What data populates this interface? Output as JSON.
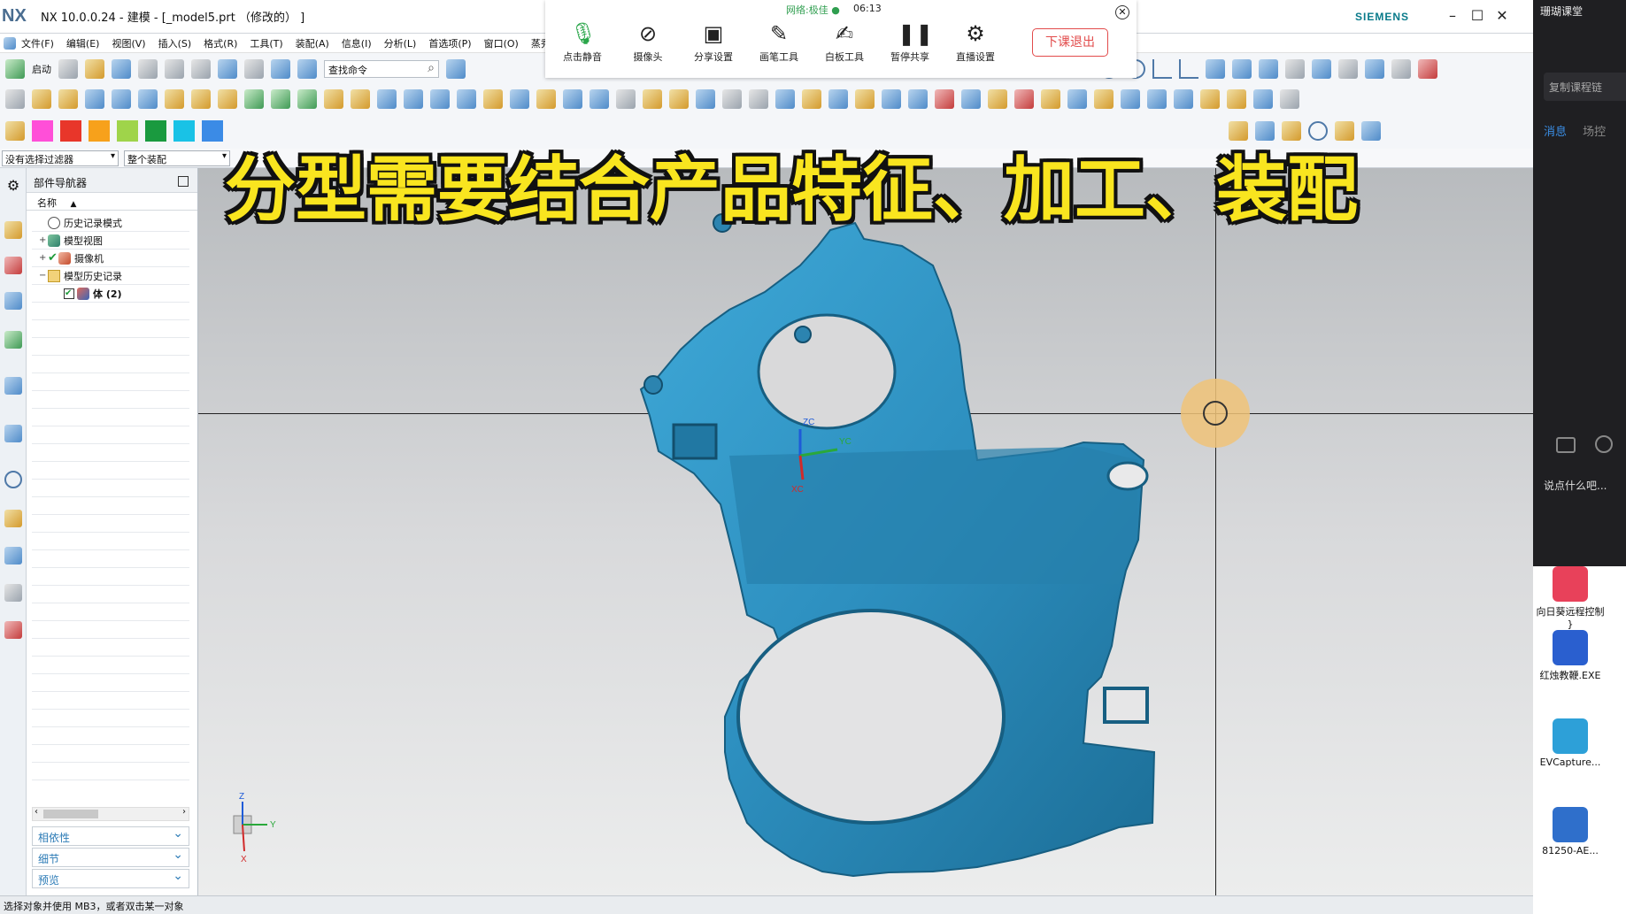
{
  "window": {
    "logo": "NX",
    "title": "NX 10.0.0.24 - 建模 - [_model5.prt （修改的） ]",
    "brand": "SIEMENS",
    "minimize": "–",
    "maximize": "☐",
    "close": "✕"
  },
  "menu": [
    "文件(F)",
    "编辑(E)",
    "视图(V)",
    "插入(S)",
    "格式(R)",
    "工具(T)",
    "装配(A)",
    "信息(I)",
    "分析(L)",
    "首选项(P)",
    "窗口(O)",
    "蒸秀"
  ],
  "toolbar": {
    "start_label": "启动",
    "search_placeholder": "查找命令"
  },
  "color_swatches": [
    "#ff4fd8",
    "#e8362a",
    "#f7a11b",
    "#9fd44a",
    "#1a9a3f",
    "#19c2e6",
    "#3b8be6"
  ],
  "filters": {
    "selection_filter": "没有选择过滤器",
    "scope": "整个装配"
  },
  "navigator": {
    "title": "部件导航器",
    "column": "名称",
    "sort_indicator": "▲",
    "items": [
      {
        "label": "历史记录模式",
        "expand": "",
        "checked": false
      },
      {
        "label": "模型视图",
        "expand": "+",
        "checked": false
      },
      {
        "label": "摄像机",
        "expand": "+",
        "checked": true
      },
      {
        "label": "模型历史记录",
        "expand": "−",
        "checked": false
      },
      {
        "label": "体 (2)",
        "expand": "",
        "checked": true
      }
    ],
    "panels": [
      "相依性",
      "细节",
      "预览"
    ]
  },
  "viewport": {
    "wcs_labels": {
      "zc": "ZC",
      "yc": "YC",
      "xc": "XC"
    },
    "triad_labels": {
      "z": "Z",
      "y": "Y",
      "x": "X"
    }
  },
  "status": "选择对象并使用 MB3，或者双击某一对象",
  "live_overlay": {
    "network": "网络:极佳 ●",
    "time": "06:13",
    "tools": [
      "点击静音",
      "摄像头",
      "分享设置",
      "画笔工具",
      "白板工具",
      "暂停共享",
      "直播设置"
    ],
    "exit_label": "下课退出",
    "close": "✕"
  },
  "caption": "分型需要结合产品特征、加工、装配",
  "side_panel": {
    "title": "珊瑚课堂",
    "copy_link": "复制课程链",
    "tabs": [
      "消息",
      "场控"
    ],
    "chat_placeholder": "说点什么吧..."
  },
  "desktop": [
    {
      "label": "向日葵远程控制",
      "color": "#e8415a"
    },
    {
      "label": "红烛教鞭.EXE",
      "color": "#2a5fcf"
    },
    {
      "label": "EVCapture...",
      "color": "#2da0d8"
    },
    {
      "label": "81250-AE...",
      "color": "#2f6fcb"
    }
  ]
}
